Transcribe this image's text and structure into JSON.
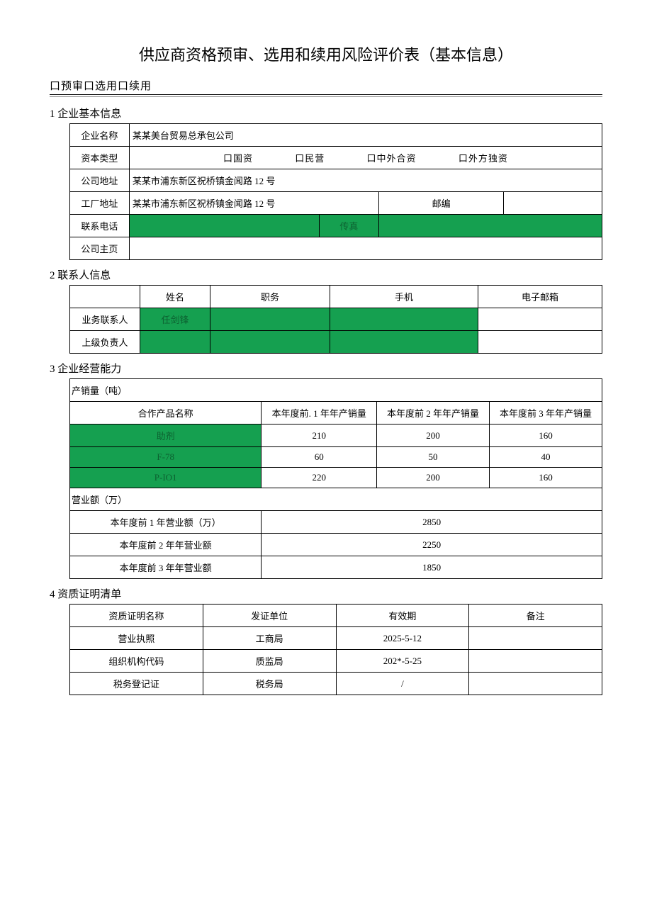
{
  "title": "供应商资格预审、选用和续用风险评价表（基本信息）",
  "checkbox_line": "口预审口选用口续用",
  "s1": {
    "heading": "1 企业基本信息",
    "labels": {
      "name": "企业名称",
      "captype": "资本类型",
      "addr": "公司地址",
      "faddr": "工厂地址",
      "zip": "邮编",
      "tel": "联系电话",
      "fax": "传真",
      "home": "公司主页"
    },
    "captype_opts": [
      "口国资",
      "口民营",
      "口中外合资",
      "口外方独资"
    ],
    "values": {
      "name": "某某美台贸易总承包公司",
      "addr": "某某市浦东新区祝桥镇金闻路 12 号",
      "faddr": "某某市浦东新区祝桥镇金闻路 12 号",
      "zip": "",
      "tel": "",
      "fax": "",
      "home": ""
    }
  },
  "s2": {
    "heading": "2 联系人信息",
    "cols": [
      "",
      "姓名",
      "职务",
      "手机",
      "电子邮箱"
    ],
    "rows": [
      {
        "lbl": "业务联系人",
        "name": "任剑锋",
        "pos": "",
        "mob": "",
        "mail": "",
        "name_green": true,
        "pos_green": true,
        "mob_green": true,
        "mail_green": false
      },
      {
        "lbl": "上级负责人",
        "name": "",
        "pos": "",
        "mob": "",
        "mail": "",
        "name_green": true,
        "pos_green": true,
        "mob_green": true,
        "mail_green": false
      }
    ]
  },
  "s3": {
    "heading": "3 企业经营能力",
    "sub1": "产销量（吨）",
    "cols": [
      "合作产品名称",
      "本年度前. 1 年年产销量",
      "本年度前 2 年年产销量",
      "本年度前 3 年年产销量"
    ],
    "rows": [
      {
        "n": "助剂",
        "v1": "210",
        "v2": "200",
        "v3": "160"
      },
      {
        "n": "F-78",
        "v1": "60",
        "v2": "50",
        "v3": "40"
      },
      {
        "n": "P-IO1",
        "v1": "220",
        "v2": "200",
        "v3": "160"
      }
    ],
    "sub2": "营业额（万）",
    "rev": [
      {
        "l": "本年度前 1 年营业额（万）",
        "v": "2850"
      },
      {
        "l": "本年度前 2 年年营业额",
        "v": "2250"
      },
      {
        "l": "本年度前 3 年年营业额",
        "v": "1850"
      }
    ]
  },
  "s4": {
    "heading": "4 资质证明清单",
    "cols": [
      "资质证明名称",
      "发证单位",
      "有效期",
      "备注"
    ],
    "rows": [
      {
        "a": "营业执照",
        "b": "工商局",
        "c": "2025-5-12",
        "d": ""
      },
      {
        "a": "组织机构代码",
        "b": "质监局",
        "c": "202*-5-25",
        "d": ""
      },
      {
        "a": "税务登记证",
        "b": "税务局",
        "c": "/",
        "d": ""
      }
    ]
  }
}
